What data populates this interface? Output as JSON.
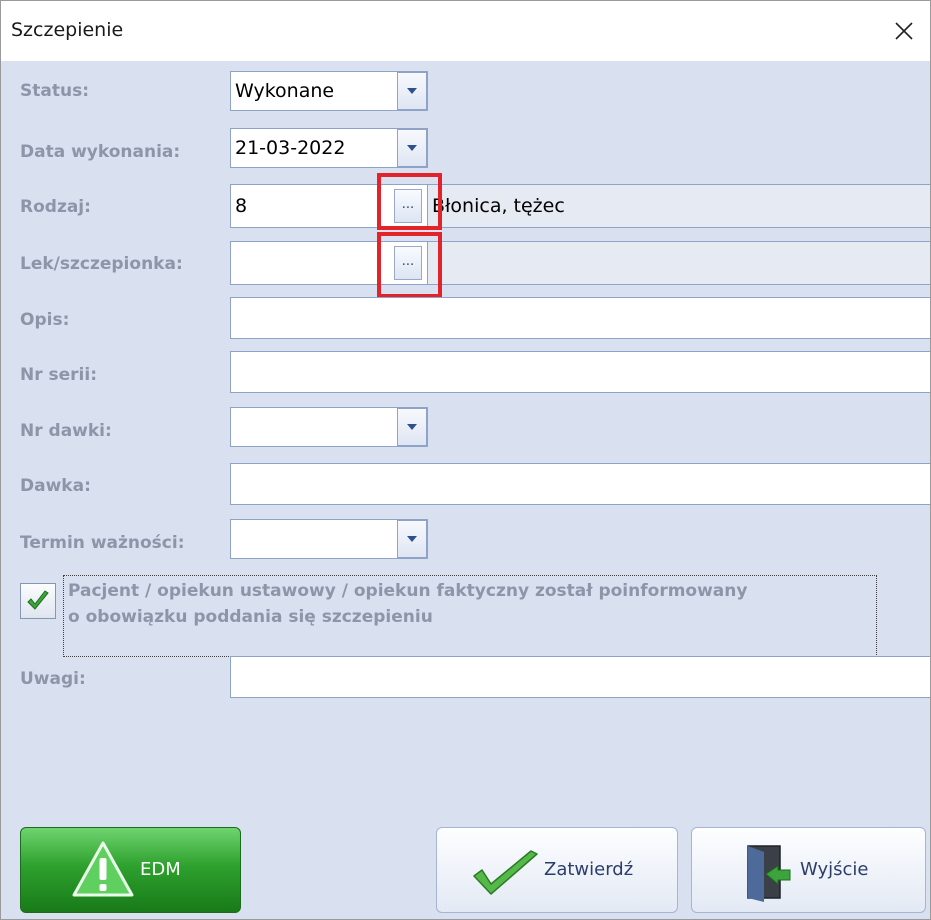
{
  "window": {
    "title": "Szczepienie"
  },
  "colors": {
    "background": "#d9e0ef",
    "label": "#8d95a8",
    "highlight": "#e3232a",
    "edm_green": "#2ea12e"
  },
  "form": {
    "status": {
      "label": "Status:",
      "value": "Wykonane"
    },
    "date": {
      "label": "Data wykonania:",
      "value": "21-03-2022"
    },
    "rodzaj": {
      "label": "Rodzaj:",
      "code": "8",
      "button": "...",
      "description": "Błonica, tężec"
    },
    "lek": {
      "label": "Lek/szczepionka:",
      "code": "",
      "button": "...",
      "description": ""
    },
    "opis": {
      "label": "Opis:",
      "value": ""
    },
    "nr_serii": {
      "label": "Nr serii:",
      "value": ""
    },
    "nr_dawki": {
      "label": "Nr dawki:",
      "value": ""
    },
    "dawka": {
      "label": "Dawka:",
      "value": ""
    },
    "termin": {
      "label": "Termin ważności:",
      "value": ""
    },
    "informed": {
      "checked": true,
      "line1": "Pacjent / opiekun ustawowy / opiekun faktyczny został poinformowany",
      "line2": "o obowiązku poddania się szczepieniu"
    },
    "uwagi": {
      "label": "Uwagi:",
      "value": ""
    }
  },
  "buttons": {
    "edm": "EDM",
    "confirm": "Zatwierdź",
    "exit": "Wyjście"
  },
  "icons": [
    "close-icon",
    "dropdown-arrow-icon",
    "checkmark-icon",
    "warning-icon",
    "exit-door-icon"
  ]
}
